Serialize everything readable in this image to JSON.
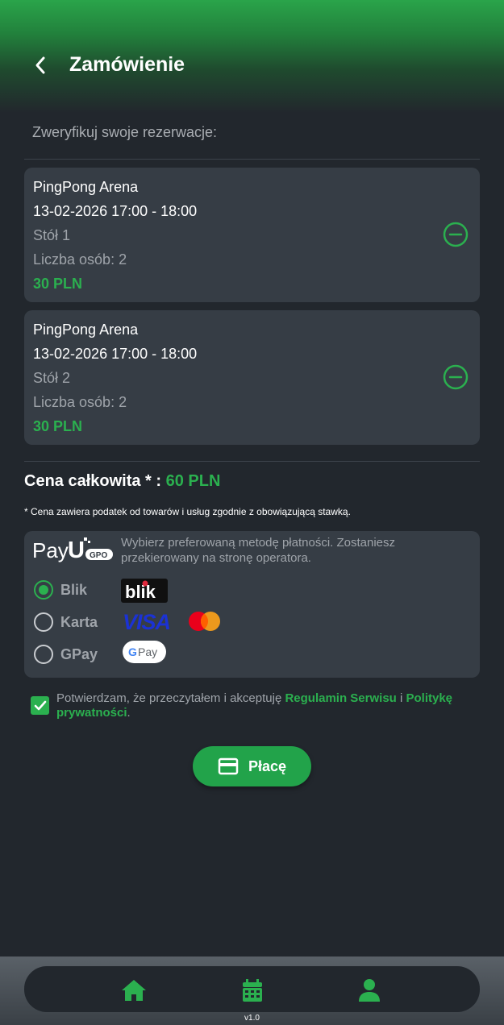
{
  "header": {
    "title": "Zamówienie"
  },
  "subtitle": "Zweryfikuj swoje rezerwacje:",
  "reservations": [
    {
      "venue": "PingPong Arena",
      "datetime": "13-02-2026 17:00 - 18:00",
      "table": "Stół 1",
      "persons": "Liczba osób: 2",
      "price": "30 PLN"
    },
    {
      "venue": "PingPong Arena",
      "datetime": "13-02-2026 17:00 - 18:00",
      "table": "Stół 2",
      "persons": "Liczba osób: 2",
      "price": "30 PLN"
    }
  ],
  "total": {
    "label": "Cena całkowita * :",
    "amount": "60 PLN"
  },
  "tax_note": "* Cena zawiera podatek od towarów i usług zgodnie z obowiązującą stawką.",
  "payment": {
    "provider_logo": "PayU GPO",
    "description": "Wybierz preferowaną metodę płatności. Zostaniesz przekierowany na stronę operatora.",
    "methods": [
      {
        "label": "Blik",
        "selected": true,
        "logo": "blik-logo"
      },
      {
        "label": "Karta",
        "selected": false,
        "logo": "visa-mastercard-logo"
      },
      {
        "label": "GPay",
        "selected": false,
        "logo": "google-pay-logo"
      }
    ]
  },
  "terms": {
    "checked": true,
    "text_before": "Potwierdzam, że przeczytałem i akceptuję ",
    "link1": "Regulamin Serwisu",
    "middle": " i ",
    "link2": "Politykę prywatności",
    "text_after": "."
  },
  "pay_button": {
    "label": "Płacę",
    "icon": "credit-card-icon"
  },
  "nav": {
    "items": [
      "home-icon",
      "calendar-icon",
      "user-icon"
    ]
  },
  "version": "v1.0",
  "colors": {
    "accent": "#2bb04f",
    "background": "#22272d",
    "card": "#363d45"
  }
}
